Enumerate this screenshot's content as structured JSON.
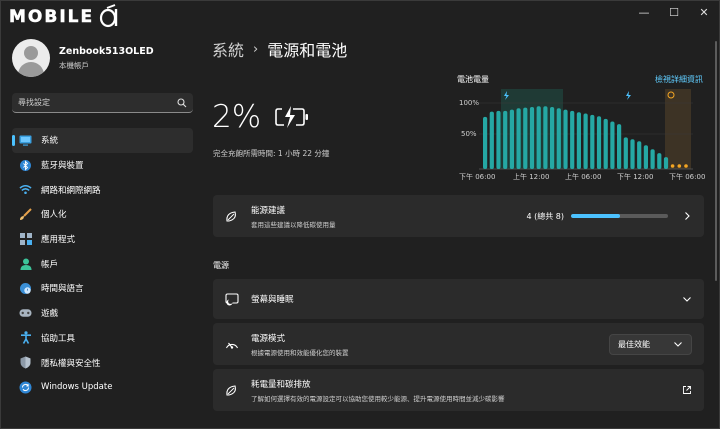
{
  "brand": {
    "logo_text": "MOBILE"
  },
  "window_controls": [
    "—",
    "☐",
    "✕"
  ],
  "profile": {
    "name": "Zenbook513OLED",
    "account": "本機帳戶"
  },
  "search": {
    "placeholder": "尋找設定"
  },
  "sidebar": {
    "items": [
      {
        "label": "系統",
        "icon": "monitor-icon",
        "active": true
      },
      {
        "label": "藍牙與裝置",
        "icon": "bluetooth-icon"
      },
      {
        "label": "網路和網際網路",
        "icon": "wifi-icon"
      },
      {
        "label": "個人化",
        "icon": "brush-icon"
      },
      {
        "label": "應用程式",
        "icon": "apps-icon"
      },
      {
        "label": "帳戶",
        "icon": "person-icon"
      },
      {
        "label": "時間與語言",
        "icon": "globe-clock-icon"
      },
      {
        "label": "遊戲",
        "icon": "gamepad-icon"
      },
      {
        "label": "協助工具",
        "icon": "accessibility-icon"
      },
      {
        "label": "隱私權與安全性",
        "icon": "shield-icon"
      },
      {
        "label": "Windows Update",
        "icon": "update-icon"
      }
    ]
  },
  "header": {
    "parent": "系統",
    "separator": "›",
    "current": "電源和電池"
  },
  "battery": {
    "percent": "2%",
    "charge_time": "完全充飽所需時間: 1 小時 22 分鐘",
    "level": 0.02
  },
  "chart": {
    "title": "電池電量",
    "link": "檢視詳細資訊",
    "y_ticks": [
      "100%",
      "50%"
    ],
    "x_ticks": [
      "下午 06:00",
      "上午 12:00",
      "上午 06:00",
      "下午 12:00",
      "下午 06:00"
    ]
  },
  "chart_data": {
    "type": "bar",
    "title": "電池電量",
    "ylim": [
      0,
      100
    ],
    "y_ticks": [
      "100%",
      "50%"
    ],
    "x_ticks": [
      "下午 06:00",
      "上午 12:00",
      "上午 06:00",
      "下午 12:00",
      "下午 06:00"
    ],
    "values": [
      79,
      87,
      88,
      88,
      90,
      92,
      93,
      94,
      95,
      95,
      94,
      92,
      90,
      88,
      86,
      84,
      82,
      80,
      76,
      72,
      68,
      48,
      45,
      42,
      36,
      30,
      24,
      18,
      4,
      4,
      4
    ],
    "low_battery_tail_count": 3,
    "colors": {
      "bar": "#25a8a4",
      "charging_bg": "#1f3a35",
      "low_bg": "#4a3a24",
      "low_dot": "#f5a623"
    }
  },
  "recommendations": {
    "title": "能源建議",
    "subtitle": "套用這些建議以降低碳使用量",
    "count": "4 (總共 8)",
    "progress": 0.5
  },
  "power_section": {
    "label": "電源"
  },
  "screen_sleep": {
    "title": "螢幕與睡眠"
  },
  "power_mode": {
    "title": "電源模式",
    "subtitle": "根據電源使用和效能優化您的裝置",
    "selected": "最佳效能"
  },
  "energy_carbon": {
    "title": "耗電量和碳排放",
    "subtitle": "了解如何選擇有效的電源設定可以協助您使用較少能源、提升電源使用時間並減少碳影響"
  }
}
